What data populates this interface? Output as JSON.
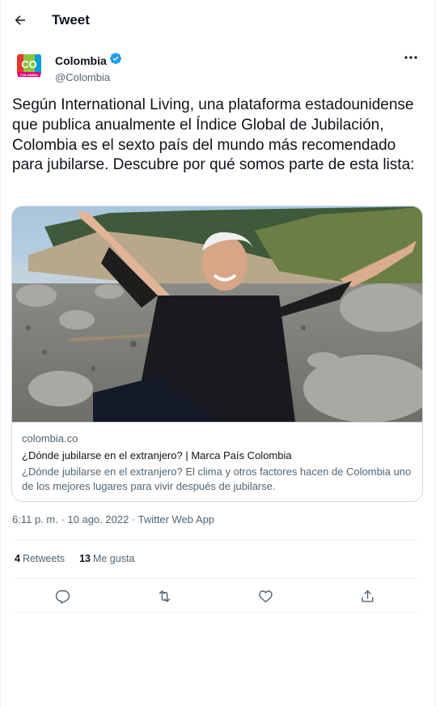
{
  "header": {
    "title": "Tweet",
    "back_icon": "arrow-left-icon"
  },
  "author": {
    "avatar_text": "CO",
    "avatar_subtext": "COLOMBIA",
    "name": "Colombia",
    "handle": "@Colombia",
    "verified_icon": "verified-badge-icon",
    "more_icon": "more-options-icon"
  },
  "tweet": {
    "text": "Según International Living, una plataforma estadounidense que publica anualmente el Índice Global de Jubilación, Colombia es el sexto país del mundo más recomendado para jubilarse. Descubre por qué somos parte de esta lista:"
  },
  "card": {
    "image_icon": "photo-smiling-man-beach",
    "domain": "colombia.co",
    "title": "¿Dónde jubilarse en el extranjero? | Marca País Colombia",
    "description": "¿Dónde jubilarse en el extranjero? El clima y otros factores hacen de Colombia uno de los mejores lugares para vivir después de jubilarse."
  },
  "meta": {
    "timestamp": "6:11 p. m. · 10 ago. 2022 · Twitter Web App"
  },
  "stats": {
    "retweets_count": "4",
    "retweets_label": "Retweets",
    "likes_count": "13",
    "likes_label": "Me gusta"
  },
  "actions": {
    "reply_icon": "reply-icon",
    "retweet_icon": "retweet-icon",
    "like_icon": "heart-icon",
    "share_icon": "share-icon"
  },
  "colors": {
    "text": "#0f1419",
    "secondary": "#536471",
    "verified": "#1d9bf0",
    "border": "#cfd9de"
  }
}
